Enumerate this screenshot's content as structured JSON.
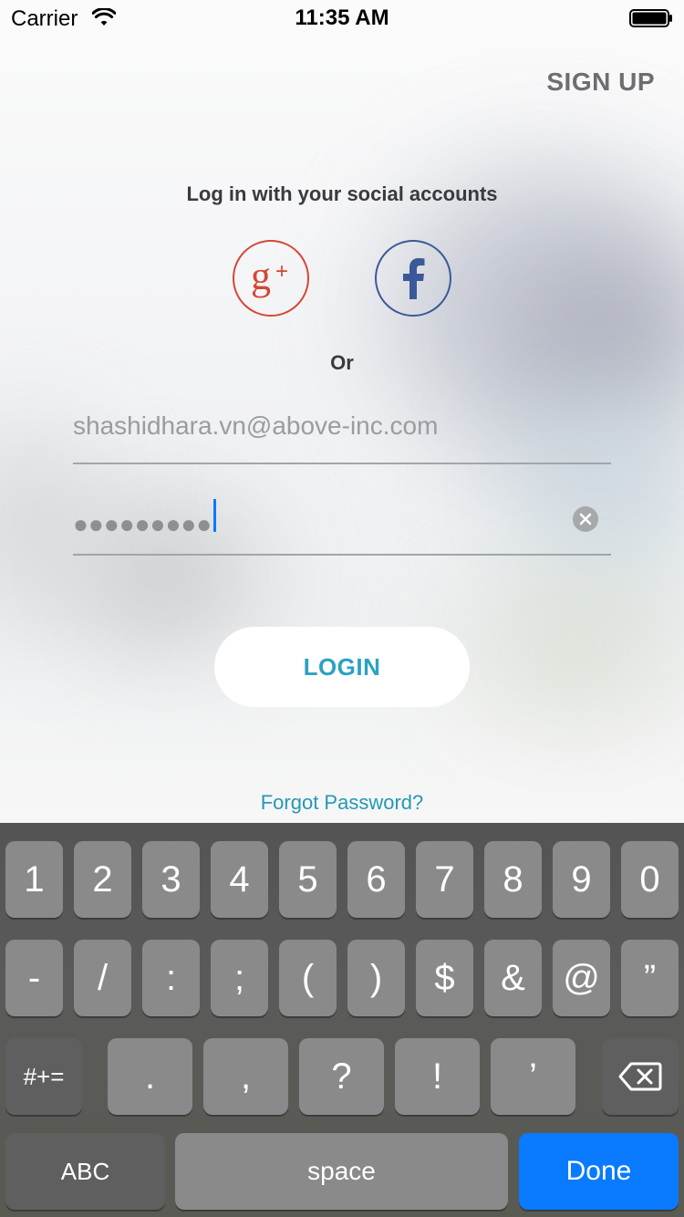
{
  "status_bar": {
    "carrier": "Carrier",
    "time": "11:35 AM"
  },
  "header": {
    "signup_label": "SIGN UP"
  },
  "social": {
    "title": "Log in with your social accounts",
    "google_icon": "google-plus-icon",
    "facebook_icon": "facebook-icon",
    "google_color": "#d34836",
    "facebook_color": "#3b5998"
  },
  "separator": {
    "or_label": "Or"
  },
  "form": {
    "email_value": "shashidhara.vn@above-inc.com",
    "password_dots": "●●●●●●●●●",
    "login_label": "LOGIN",
    "forgot_label": "Forgot Password?"
  },
  "keyboard": {
    "row1": [
      "1",
      "2",
      "3",
      "4",
      "5",
      "6",
      "7",
      "8",
      "9",
      "0"
    ],
    "row2": [
      "-",
      "/",
      ":",
      ";",
      "(",
      ")",
      "$",
      "&",
      "@",
      "”"
    ],
    "row3_left": "#+=",
    "row3_middle": [
      ".",
      ",",
      "?",
      "!",
      "’"
    ],
    "abc_label": "ABC",
    "space_label": "space",
    "done_label": "Done",
    "done_color": "#0a7aff"
  }
}
